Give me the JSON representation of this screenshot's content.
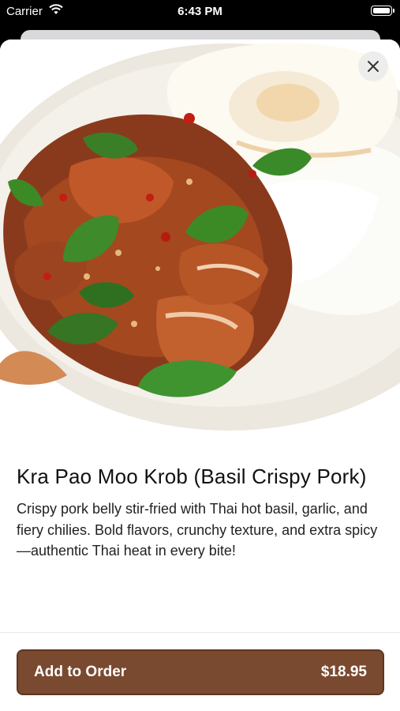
{
  "status_bar": {
    "carrier": "Carrier",
    "time": "6:43 PM"
  },
  "hero": {
    "image_description_icon": "food-photo",
    "close_icon": "close-icon"
  },
  "item": {
    "name": "Kra Pao Moo Krob (Basil Crispy Pork)",
    "description": "Crispy pork belly stir-fried with Thai hot basil, garlic, and fiery chilies. Bold flavors, crunchy texture, and extra spicy—authentic Thai heat in every bite!"
  },
  "action": {
    "label": "Add to Order",
    "price": "$18.95"
  },
  "colors": {
    "button_bg": "#7a4a30",
    "button_border": "#5e3520"
  }
}
